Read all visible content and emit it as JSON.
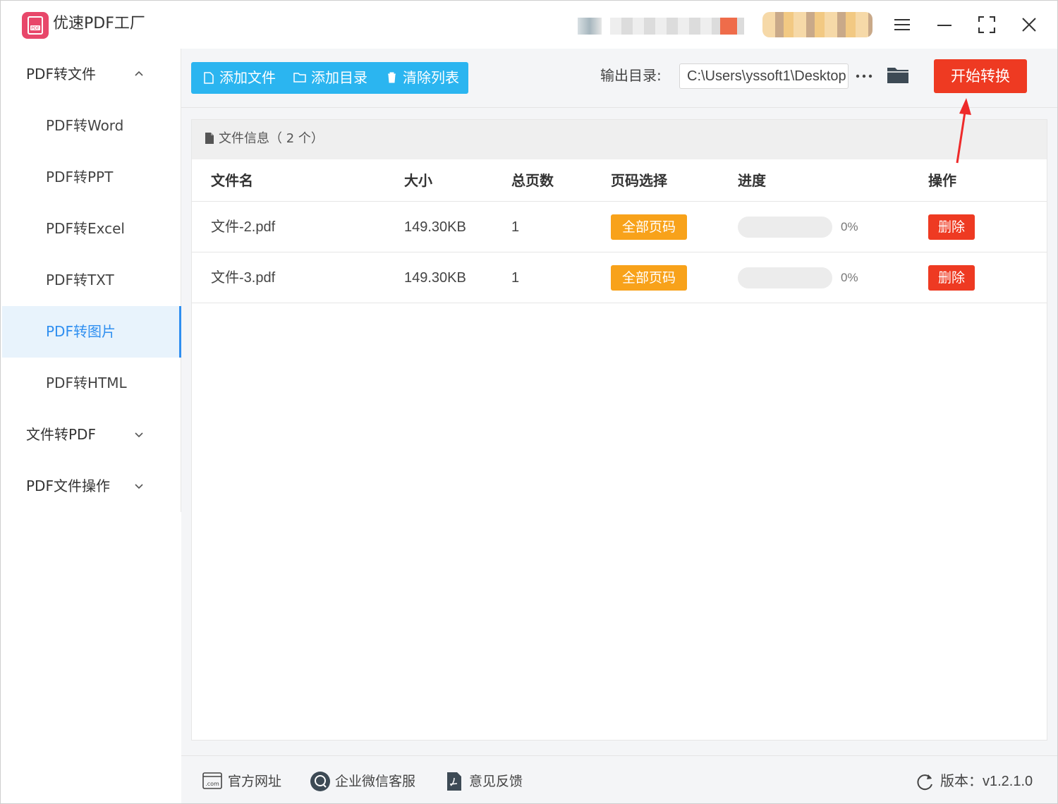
{
  "app": {
    "title": "优速PDF工厂"
  },
  "colors": {
    "accent": "#2bb5f0",
    "start": "#ee3a22",
    "tag": "#f8a21a",
    "delete": "#ee3a22",
    "active_text": "#2f8ff0"
  },
  "sidebar": {
    "groups": [
      {
        "label": "PDF转文件",
        "expanded": true,
        "items": [
          {
            "label": "PDF转Word"
          },
          {
            "label": "PDF转PPT"
          },
          {
            "label": "PDF转Excel"
          },
          {
            "label": "PDF转TXT"
          },
          {
            "label": "PDF转图片",
            "active": true
          },
          {
            "label": "PDF转HTML"
          }
        ]
      },
      {
        "label": "文件转PDF",
        "expanded": false
      },
      {
        "label": "PDF文件操作",
        "expanded": false
      }
    ]
  },
  "toolbar": {
    "add_file": "添加文件",
    "add_dir": "添加目录",
    "clear_list": "清除列表",
    "output_label": "输出目录:",
    "output_path": "C:\\Users\\yssoft1\\Desktop",
    "start": "开始转换"
  },
  "file_info": {
    "title": "文件信息（ 2 个）"
  },
  "table": {
    "headers": {
      "name": "文件名",
      "size": "大小",
      "pages": "总页数",
      "page_select": "页码选择",
      "progress": "进度",
      "action": "操作"
    },
    "rows": [
      {
        "name": "文件-2.pdf",
        "size": "149.30KB",
        "pages": "1",
        "page_select": "全部页码",
        "progress": 0,
        "progress_text": "0%",
        "action": "删除"
      },
      {
        "name": "文件-3.pdf",
        "size": "149.30KB",
        "pages": "1",
        "page_select": "全部页码",
        "progress": 0,
        "progress_text": "0%",
        "action": "删除"
      }
    ]
  },
  "footer": {
    "website": "官方网址",
    "wechat": "企业微信客服",
    "feedback": "意见反馈",
    "version": "版本：v1.2.1.0"
  }
}
